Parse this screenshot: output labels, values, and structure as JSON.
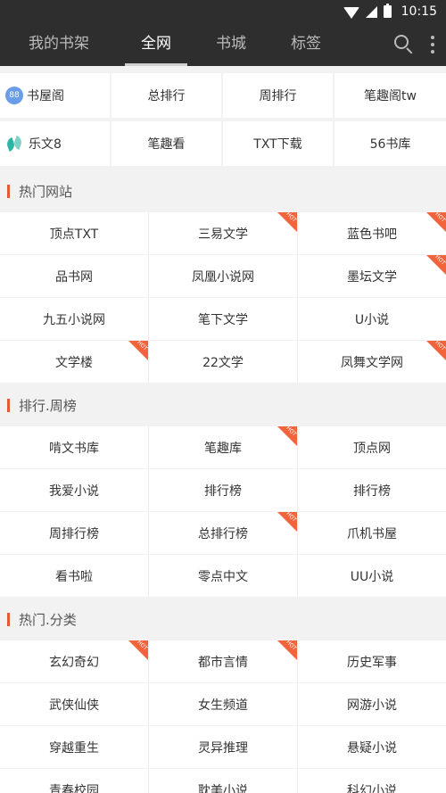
{
  "status": {
    "time": "10:15"
  },
  "tabs": [
    "我的书架",
    "全网",
    "书城",
    "标签"
  ],
  "sites": {
    "row1": [
      "书屋阁",
      "总排行",
      "周排行",
      "笔趣阁tw"
    ],
    "row2": [
      "乐文8",
      "笔趣看",
      "TXT下载",
      "56书库"
    ]
  },
  "hot_badge": "HOT",
  "sections": [
    {
      "title": "热门网站",
      "rows": [
        [
          {
            "t": "顶点TXT",
            "hot": false
          },
          {
            "t": "三易文学",
            "hot": true
          },
          {
            "t": "蓝色书吧",
            "hot": true
          }
        ],
        [
          {
            "t": "品书网",
            "hot": false
          },
          {
            "t": "凤凰小说网",
            "hot": false
          },
          {
            "t": "墨坛文学",
            "hot": true
          }
        ],
        [
          {
            "t": "九五小说网",
            "hot": false
          },
          {
            "t": "笔下文学",
            "hot": false
          },
          {
            "t": "U小说",
            "hot": false
          }
        ],
        [
          {
            "t": "文学楼",
            "hot": true
          },
          {
            "t": "22文学",
            "hot": false
          },
          {
            "t": "凤舞文学网",
            "hot": true
          }
        ]
      ]
    },
    {
      "title": "排行.周榜",
      "rows": [
        [
          {
            "t": "啃文书库",
            "hot": false
          },
          {
            "t": "笔趣库",
            "hot": true
          },
          {
            "t": "顶点网",
            "hot": false
          }
        ],
        [
          {
            "t": "我爱小说",
            "hot": false
          },
          {
            "t": "排行榜",
            "hot": false
          },
          {
            "t": "排行榜",
            "hot": false
          }
        ],
        [
          {
            "t": "周排行榜",
            "hot": false
          },
          {
            "t": "总排行榜",
            "hot": true
          },
          {
            "t": "爪机书屋",
            "hot": false
          }
        ],
        [
          {
            "t": "看书啦",
            "hot": false
          },
          {
            "t": "零点中文",
            "hot": false
          },
          {
            "t": "UU小说",
            "hot": false
          }
        ]
      ]
    },
    {
      "title": "热门.分类",
      "rows": [
        [
          {
            "t": "玄幻奇幻",
            "hot": true
          },
          {
            "t": "都市言情",
            "hot": true
          },
          {
            "t": "历史军事",
            "hot": false
          }
        ],
        [
          {
            "t": "武侠仙侠",
            "hot": false
          },
          {
            "t": "女生频道",
            "hot": false
          },
          {
            "t": "网游小说",
            "hot": false
          }
        ],
        [
          {
            "t": "穿越重生",
            "hot": false
          },
          {
            "t": "灵异推理",
            "hot": false
          },
          {
            "t": "悬疑小说",
            "hot": false
          }
        ],
        [
          {
            "t": "青春校园",
            "hot": false
          },
          {
            "t": "耽美小说",
            "hot": false
          },
          {
            "t": "科幻小说",
            "hot": false
          }
        ]
      ]
    }
  ]
}
